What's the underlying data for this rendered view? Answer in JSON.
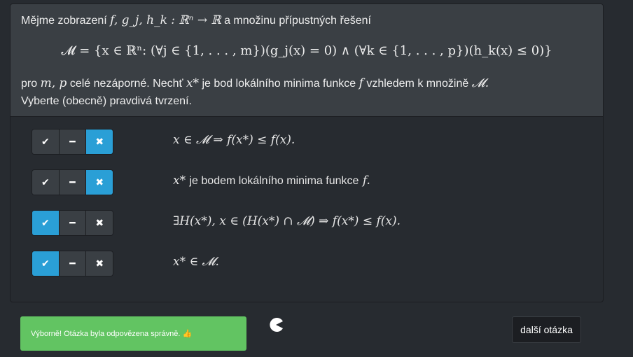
{
  "question": {
    "intro_prefix": "Mějme zobrazení",
    "intro_math": "f, g_j, h_k : ℝⁿ → ℝ",
    "intro_suffix": "a množinu přípustných řešení",
    "set_formula": "𝓜 = {x ∈ ℝⁿ: (∀j ∈ {1, . . . , m})(g_j(x) = 0)  ∧  (∀k ∈ {1, . . . , p})(h_k(x) ≤ 0)}",
    "line3_prefix": "pro",
    "line3_math1": "m, p",
    "line3_mid": "celé nezáporné. Nechť",
    "line3_math2": "x*",
    "line3_mid2": "je bod lokálního minima funkce",
    "line3_math3": "f",
    "line3_mid3": "vzhledem k množině",
    "line3_math4": "𝓜.",
    "line4": "Vyberte (obecně) pravdivá tvrzení."
  },
  "answer_controls": {
    "true_icon": "check-icon",
    "neutral_icon": "minus-icon",
    "false_icon": "cross-icon",
    "true_glyph": "✔",
    "neutral_glyph": "━",
    "false_glyph": "✖"
  },
  "statements": [
    {
      "math": "x ∈ 𝓜 ⇒ f(x*) ≤ f(x).",
      "text": "",
      "tail": "",
      "selected": "false"
    },
    {
      "math": "x*",
      "text": "je bodem lokálního minima funkce",
      "tail": "f.",
      "selected": "false"
    },
    {
      "math": "∃H(x*), x ∈ (H(x*) ∩ 𝓜) ⇒ f(x*) ≤ f(x).",
      "text": "",
      "tail": "",
      "selected": "true"
    },
    {
      "math": "x* ∈ 𝓜.",
      "text": "",
      "tail": "",
      "selected": "true"
    }
  ],
  "feedback": {
    "message": "Výborně! Otázka byla odpovězena správně. 👍",
    "color": "#62c462"
  },
  "next_button": {
    "label": "další otázka"
  },
  "colors": {
    "active": "#2a9fd6",
    "background": "#272b30",
    "header": "#3a3f44"
  }
}
